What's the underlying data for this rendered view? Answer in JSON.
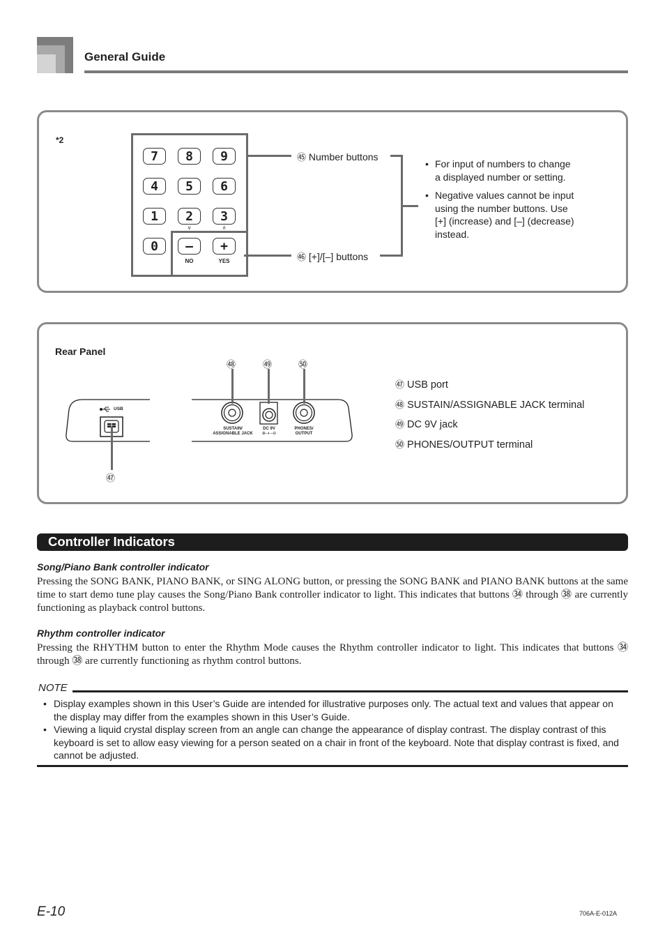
{
  "header": {
    "title": "General Guide"
  },
  "keypad_panel": {
    "footnote": "*2",
    "keys": [
      "7",
      "8",
      "9",
      "4",
      "5",
      "6",
      "1",
      "2",
      "3",
      "0",
      "–",
      "+"
    ],
    "arrow_under_2": "∨",
    "arrow_under_3": "∧",
    "minus_sub": "NO",
    "plus_sub": "YES",
    "callouts": [
      {
        "num": "㊺",
        "label": "Number buttons"
      },
      {
        "num": "㊻",
        "label": "[+]/[–] buttons"
      }
    ],
    "bullets": [
      "For input of numbers to change a displayed number or setting.",
      "Negative values cannot be input using the number buttons. Use [+] (increase) and [–] (decrease) instead."
    ]
  },
  "rear_panel": {
    "title": "Rear Panel",
    "usb_label": "USB",
    "jack_labels": {
      "sustain": "SUSTAIN/\nASSIGNABLE JACK",
      "dc": "DC 9V",
      "dc_polarity": "⊕–◐–⊖",
      "phones": "PHONES/\nOUTPUT"
    },
    "tags": {
      "usb": "㊼",
      "sustain": "㊽",
      "dc": "㊾",
      "phones": "㊿"
    },
    "items": [
      {
        "num": "㊼",
        "label": "USB port"
      },
      {
        "num": "㊽",
        "label": "SUSTAIN/ASSIGNABLE JACK terminal"
      },
      {
        "num": "㊾",
        "label": "DC 9V jack"
      },
      {
        "num": "㊿",
        "label": "PHONES/OUTPUT terminal"
      }
    ]
  },
  "section": {
    "title": "Controller Indicators",
    "subsections": [
      {
        "heading": "Song/Piano Bank controller indicator",
        "body": "Pressing the SONG BANK, PIANO BANK, or SING ALONG button, or pressing the SONG BANK and PIANO BANK buttons at the same time to start demo tune play causes the Song/Piano Bank controller indicator to light. This indicates that buttons ㉞ through ㊳ are currently functioning as playback control buttons."
      },
      {
        "heading": "Rhythm controller indicator",
        "body": "Pressing the RHYTHM button to enter the Rhythm Mode causes the Rhythm controller indicator to light. This indicates that buttons ㉞ through ㊳ are currently functioning as rhythm control buttons."
      }
    ]
  },
  "note": {
    "label": "NOTE",
    "items": [
      "Display examples shown in this User’s Guide are intended for illustrative purposes only. The actual text and values that appear on the display may differ from the examples shown in this User’s Guide.",
      "Viewing a liquid crystal display screen from an angle can change the appearance of display contrast. The display contrast of this keyboard is set to allow easy viewing for a person seated on a chair in front of the keyboard. Note that display contrast is fixed, and cannot be adjusted."
    ]
  },
  "footer": {
    "page_number": "E-10",
    "doc_code": "706A-E-012A"
  }
}
